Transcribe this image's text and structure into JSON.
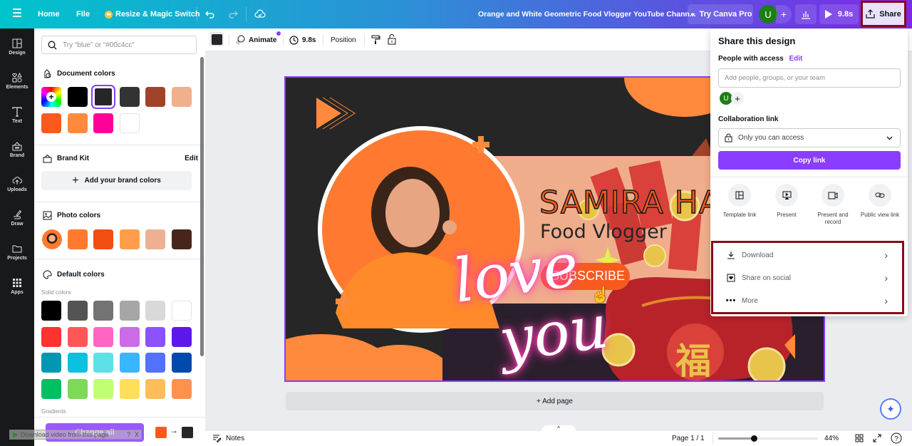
{
  "topbar": {
    "menu_icon": "hamburger-icon",
    "home": "Home",
    "file": "File",
    "resize": "Resize & Magic Switch",
    "title": "Orange and White Geometric Food Vlogger YouTube Chann...",
    "try_pro": "Try Canva Pro",
    "avatar_initial": "U",
    "add": "+",
    "play_time": "9.8s",
    "share": "Share"
  },
  "rail": {
    "items": [
      {
        "label": "Design",
        "icon": "layout-icon"
      },
      {
        "label": "Elements",
        "icon": "shapes-icon"
      },
      {
        "label": "Text",
        "icon": "text-icon"
      },
      {
        "label": "Brand",
        "icon": "brand-icon"
      },
      {
        "label": "Uploads",
        "icon": "cloud-upload-icon"
      },
      {
        "label": "Draw",
        "icon": "pen-icon"
      },
      {
        "label": "Projects",
        "icon": "folder-icon"
      },
      {
        "label": "Apps",
        "icon": "grid-icon"
      }
    ]
  },
  "panel": {
    "search_placeholder": "Try “blue” or “#00c4cc”",
    "document_colors_title": "Document colors",
    "document_colors": [
      "#000000",
      "#262626",
      "#333333",
      "#a0432a",
      "#f0b08c",
      "#fa5a1e",
      "#ff8a3d",
      "#ff0099",
      "#ffffff"
    ],
    "selected_document_color": "#262626",
    "brand_kit_title": "Brand Kit",
    "brand_kit_edit": "Edit",
    "add_brand_colors": "Add your brand colors",
    "photo_colors_title": "Photo colors",
    "photo_colors": [
      "#ff7a30",
      "#f24e12",
      "#ff9d4a",
      "#edb192",
      "#47251c"
    ],
    "default_colors_title": "Default colors",
    "solid_colors_label": "Solid colors",
    "solid_colors": [
      [
        "#000000",
        "#545454",
        "#737373",
        "#a6a6a6",
        "#d9d9d9",
        "#ffffff"
      ],
      [
        "#ff3131",
        "#ff5757",
        "#ff66c4",
        "#cb6ce6",
        "#8c52ff",
        "#5e17eb"
      ],
      [
        "#0097b2",
        "#0cc0df",
        "#5ce1e6",
        "#38b6ff",
        "#5271ff",
        "#004aad"
      ],
      [
        "#00bf63",
        "#7ed957",
        "#c1ff72",
        "#ffde59",
        "#ffbd59",
        "#ff914d"
      ]
    ],
    "gradients_label": "Gradients",
    "change_all": "Change all",
    "replace_from": "#fa5a1e",
    "replace_to": "#262626",
    "download_overlay": "Download video from this page",
    "overlay_help": "?",
    "overlay_close": "X"
  },
  "toolbar": {
    "color_swatch": "#262626",
    "animate": "Animate",
    "duration": "9.8s",
    "position": "Position"
  },
  "canvas": {
    "name": "SAMIRA HA",
    "subtitle": "Food Vlogger",
    "subscribe": "SUBSCRIBE",
    "script_line1": "love",
    "script_line2": "you",
    "fu_char": "福",
    "coin_char": "¥"
  },
  "add_page": "+ Add page",
  "bottombar": {
    "notes": "Notes",
    "page": "Page 1 / 1",
    "zoom": "44%",
    "zoom_fraction": 0.36
  },
  "share_panel": {
    "title": "Share this design",
    "people_label": "People with access",
    "people_edit": "Edit",
    "people_placeholder": "Add people, groups, or your team",
    "avatar_initial": "U",
    "collab_label": "Collaboration link",
    "access_value": "Only you can access",
    "copy_link": "Copy link",
    "options": [
      {
        "label": "Template link",
        "icon": "template-icon"
      },
      {
        "label": "Present",
        "icon": "presentation-icon"
      },
      {
        "label": "Present and record",
        "icon": "video-camera-icon"
      },
      {
        "label": "Public view link",
        "icon": "link-icon"
      }
    ],
    "menu": [
      {
        "label": "Download",
        "icon": "download-icon"
      },
      {
        "label": "Share on social",
        "icon": "heart-frame-icon"
      },
      {
        "label": "More",
        "icon": "more-dots-icon"
      }
    ]
  }
}
